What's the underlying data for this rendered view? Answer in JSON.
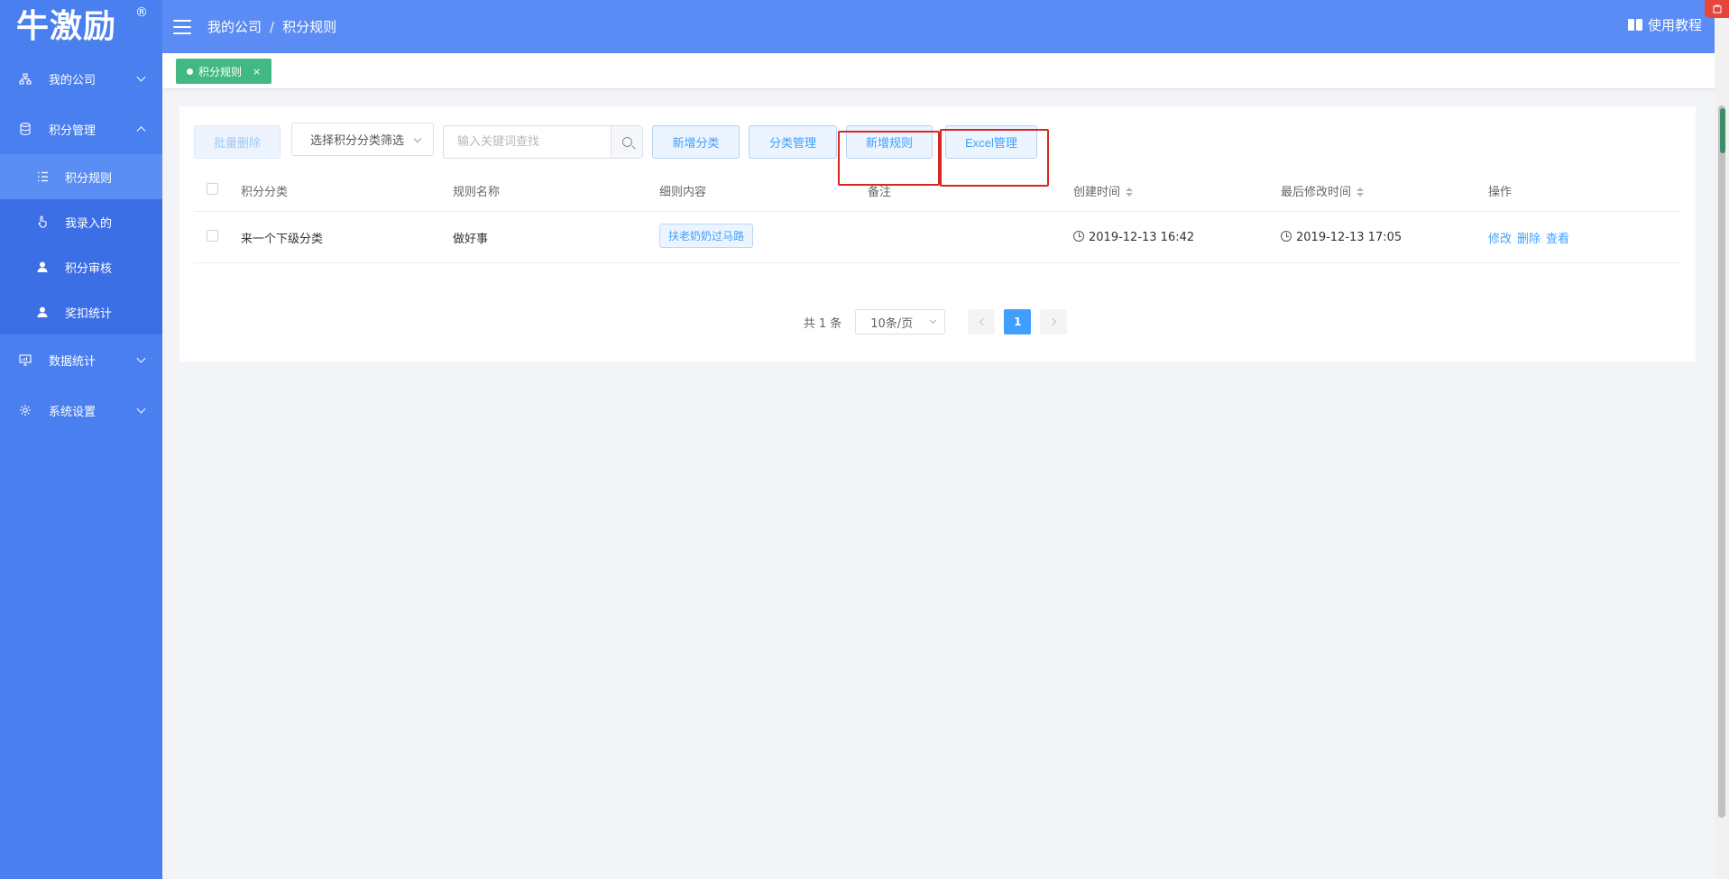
{
  "sidebar": {
    "logo": "牛激励",
    "logo_mark": "®",
    "menu": [
      {
        "label": "我的公司",
        "icon": "org-chart-icon",
        "expanded": false
      },
      {
        "label": "积分管理",
        "icon": "database-icon",
        "expanded": true
      },
      {
        "label": "数据统计",
        "icon": "monitor-chart-icon",
        "expanded": false
      },
      {
        "label": "系统设置",
        "icon": "gear-icon",
        "expanded": false
      }
    ],
    "submenu": [
      {
        "label": "积分规则",
        "icon": "list-icon",
        "active": true
      },
      {
        "label": "我录入的",
        "icon": "hand-pointer-icon",
        "active": false
      },
      {
        "label": "积分审核",
        "icon": "user-icon",
        "active": false
      },
      {
        "label": "奖扣统计",
        "icon": "user-icon",
        "active": false
      }
    ]
  },
  "header": {
    "breadcrumb": [
      "我的公司",
      "积分规则"
    ],
    "separator": "/",
    "tutorial": "使用教程"
  },
  "tabs": [
    {
      "label": "积分规则",
      "close": "×",
      "active": true
    }
  ],
  "toolbar": {
    "batch_delete": "批量删除",
    "category_select": "选择积分分类筛选",
    "search_placeholder": "输入关键词查找",
    "add_category": "新增分类",
    "manage_category": "分类管理",
    "add_rule": "新增规则",
    "excel_manage": "Excel管理"
  },
  "table": {
    "columns": [
      "积分分类",
      "规则名称",
      "细则内容",
      "备注",
      "创建时间",
      "最后修改时间",
      "操作"
    ],
    "rows": [
      {
        "category": "来一个下级分类",
        "name": "做好事",
        "detail": "扶老奶奶过马路",
        "note": "",
        "created": "2019-12-13 16:42",
        "modified": "2019-12-13 17:05",
        "actions": [
          "修改",
          "删除",
          "查看"
        ]
      }
    ]
  },
  "pagination": {
    "total": "共 1 条",
    "page_size": "10条/页",
    "current_page": "1"
  },
  "colors": {
    "sidebar": "#4a7ff0",
    "header": "#5b8cf5",
    "tag": "#42b983",
    "primary": "#409eff",
    "highlight": "#d62820"
  }
}
